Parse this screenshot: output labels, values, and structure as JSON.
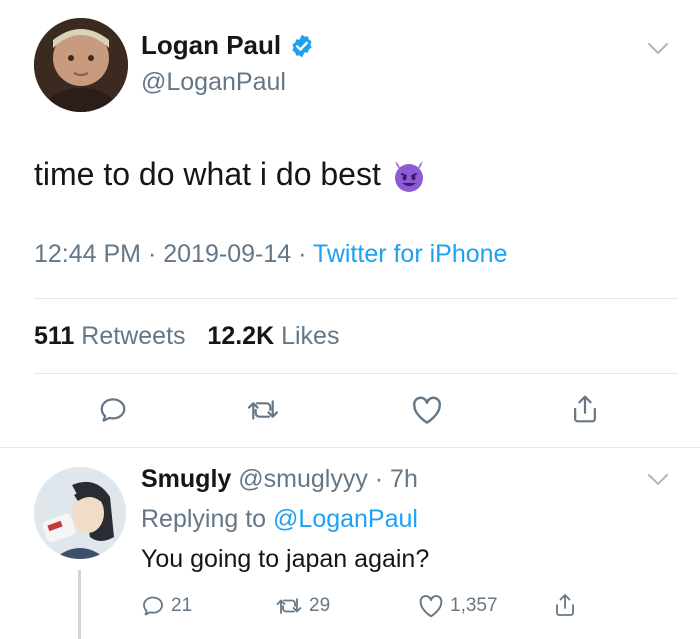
{
  "tweet": {
    "author_name": "Logan Paul",
    "author_handle": "@LoganPaul",
    "text": "time to do what i do best",
    "emoji_icon": "smiling-devil-emoji",
    "time": "12:44 PM",
    "date": "2019-09-14",
    "source": "Twitter for iPhone",
    "retweets_count": "511",
    "retweets_label": "Retweets",
    "likes_count": "12.2K",
    "likes_label": "Likes"
  },
  "reply": {
    "author_name": "Smugly",
    "author_handle": "@smuglyyy",
    "age": "7h",
    "replying_prefix": "Replying to",
    "replying_to": "@LoganPaul",
    "text": "You going to japan again?",
    "reply_count": "21",
    "retweet_count": "29",
    "like_count": "1,357"
  },
  "colors": {
    "accent": "#1da1f2",
    "secondary_text": "#657786",
    "primary_text": "#14171a",
    "divider": "#e1e8ed"
  },
  "icons": [
    "verified-badge-icon",
    "chevron-down-icon",
    "reply-icon",
    "retweet-icon",
    "like-icon",
    "share-icon"
  ]
}
